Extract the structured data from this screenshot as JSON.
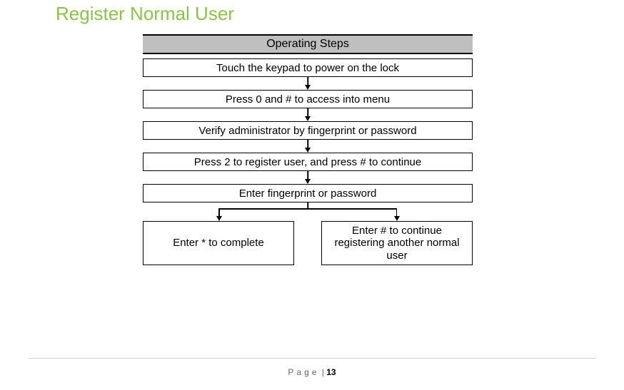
{
  "title": "Register Normal User",
  "flow": {
    "header": "Operating Steps",
    "steps": [
      "Touch the keypad to power on the lock",
      "Press  0 and  # to access into menu",
      "Verify administrator by fingerprint or password",
      "Press 2 to register user, and press # to continue",
      "Enter fingerprint or password"
    ],
    "final_left": "Enter * to complete",
    "final_right": "Enter # to continue registering another normal user"
  },
  "footer": {
    "label": "Page",
    "separator": " | ",
    "number": "13"
  }
}
